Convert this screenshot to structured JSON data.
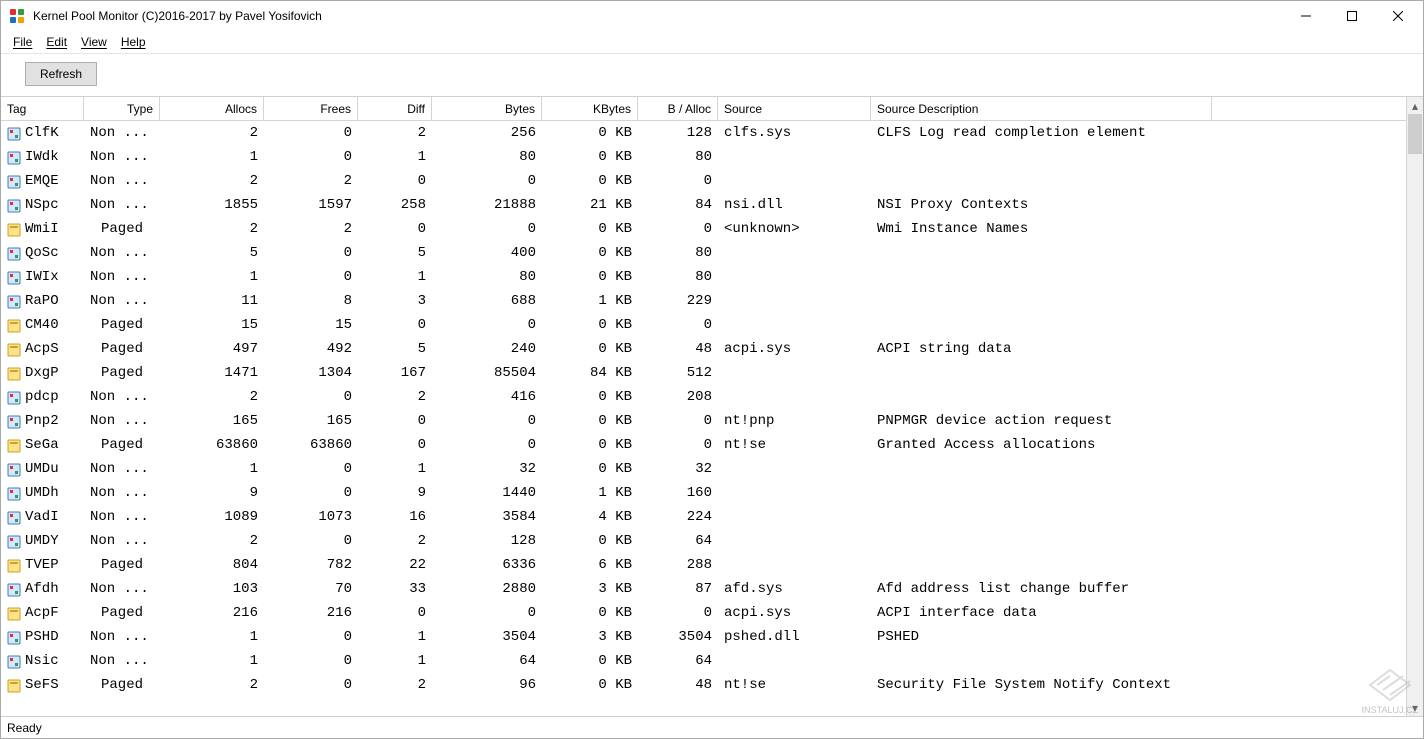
{
  "window": {
    "title": "Kernel Pool Monitor (C)2016-2017 by Pavel Yosifovich"
  },
  "menu": {
    "file": "File",
    "edit": "Edit",
    "view": "View",
    "help": "Help"
  },
  "toolbar": {
    "refresh": "Refresh"
  },
  "columns": [
    "Tag",
    "Type",
    "Allocs",
    "Frees",
    "Diff",
    "Bytes",
    "KBytes",
    "B / Alloc",
    "Source",
    "Source Description"
  ],
  "status": "Ready",
  "watermark": "INSTALUJ.CZ",
  "rows": [
    {
      "icon": "np",
      "tag": "ClfK",
      "type": "Non ...",
      "allocs": 2,
      "frees": 0,
      "diff": 2,
      "bytes": 256,
      "kbytes": "0 KB",
      "balloc": 128,
      "source": "clfs.sys",
      "desc": "CLFS Log read completion element"
    },
    {
      "icon": "np",
      "tag": "IWdk",
      "type": "Non ...",
      "allocs": 1,
      "frees": 0,
      "diff": 1,
      "bytes": 80,
      "kbytes": "0 KB",
      "balloc": 80,
      "source": "",
      "desc": ""
    },
    {
      "icon": "np",
      "tag": "EMQE",
      "type": "Non ...",
      "allocs": 2,
      "frees": 2,
      "diff": 0,
      "bytes": 0,
      "kbytes": "0 KB",
      "balloc": 0,
      "source": "",
      "desc": ""
    },
    {
      "icon": "np",
      "tag": "NSpc",
      "type": "Non ...",
      "allocs": 1855,
      "frees": 1597,
      "diff": 258,
      "bytes": 21888,
      "kbytes": "21 KB",
      "balloc": 84,
      "source": "nsi.dll",
      "desc": "NSI Proxy Contexts"
    },
    {
      "icon": "pg",
      "tag": "WmiI",
      "type": "Paged",
      "allocs": 2,
      "frees": 2,
      "diff": 0,
      "bytes": 0,
      "kbytes": "0 KB",
      "balloc": 0,
      "source": "<unknown>",
      "desc": "Wmi Instance Names"
    },
    {
      "icon": "np",
      "tag": "QoSc",
      "type": "Non ...",
      "allocs": 5,
      "frees": 0,
      "diff": 5,
      "bytes": 400,
      "kbytes": "0 KB",
      "balloc": 80,
      "source": "",
      "desc": ""
    },
    {
      "icon": "np",
      "tag": "IWIx",
      "type": "Non ...",
      "allocs": 1,
      "frees": 0,
      "diff": 1,
      "bytes": 80,
      "kbytes": "0 KB",
      "balloc": 80,
      "source": "",
      "desc": ""
    },
    {
      "icon": "np",
      "tag": "RaPO",
      "type": "Non ...",
      "allocs": 11,
      "frees": 8,
      "diff": 3,
      "bytes": 688,
      "kbytes": "1 KB",
      "balloc": 229,
      "source": "",
      "desc": ""
    },
    {
      "icon": "pg",
      "tag": "CM40",
      "type": "Paged",
      "allocs": 15,
      "frees": 15,
      "diff": 0,
      "bytes": 0,
      "kbytes": "0 KB",
      "balloc": 0,
      "source": "",
      "desc": ""
    },
    {
      "icon": "pg",
      "tag": "AcpS",
      "type": "Paged",
      "allocs": 497,
      "frees": 492,
      "diff": 5,
      "bytes": 240,
      "kbytes": "0 KB",
      "balloc": 48,
      "source": "acpi.sys",
      "desc": "ACPI string data"
    },
    {
      "icon": "pg",
      "tag": "DxgP",
      "type": "Paged",
      "allocs": 1471,
      "frees": 1304,
      "diff": 167,
      "bytes": 85504,
      "kbytes": "84 KB",
      "balloc": 512,
      "source": "",
      "desc": ""
    },
    {
      "icon": "np",
      "tag": "pdcp",
      "type": "Non ...",
      "allocs": 2,
      "frees": 0,
      "diff": 2,
      "bytes": 416,
      "kbytes": "0 KB",
      "balloc": 208,
      "source": "",
      "desc": ""
    },
    {
      "icon": "np",
      "tag": "Pnp2",
      "type": "Non ...",
      "allocs": 165,
      "frees": 165,
      "diff": 0,
      "bytes": 0,
      "kbytes": "0 KB",
      "balloc": 0,
      "source": "nt!pnp",
      "desc": "PNPMGR device action request"
    },
    {
      "icon": "pg",
      "tag": "SeGa",
      "type": "Paged",
      "allocs": 63860,
      "frees": 63860,
      "diff": 0,
      "bytes": 0,
      "kbytes": "0 KB",
      "balloc": 0,
      "source": "nt!se",
      "desc": "Granted Access allocations"
    },
    {
      "icon": "np",
      "tag": "UMDu",
      "type": "Non ...",
      "allocs": 1,
      "frees": 0,
      "diff": 1,
      "bytes": 32,
      "kbytes": "0 KB",
      "balloc": 32,
      "source": "",
      "desc": ""
    },
    {
      "icon": "np",
      "tag": "UMDh",
      "type": "Non ...",
      "allocs": 9,
      "frees": 0,
      "diff": 9,
      "bytes": 1440,
      "kbytes": "1 KB",
      "balloc": 160,
      "source": "",
      "desc": ""
    },
    {
      "icon": "np",
      "tag": "VadI",
      "type": "Non ...",
      "allocs": 1089,
      "frees": 1073,
      "diff": 16,
      "bytes": 3584,
      "kbytes": "4 KB",
      "balloc": 224,
      "source": "",
      "desc": ""
    },
    {
      "icon": "np",
      "tag": "UMDY",
      "type": "Non ...",
      "allocs": 2,
      "frees": 0,
      "diff": 2,
      "bytes": 128,
      "kbytes": "0 KB",
      "balloc": 64,
      "source": "",
      "desc": ""
    },
    {
      "icon": "pg",
      "tag": "TVEP",
      "type": "Paged",
      "allocs": 804,
      "frees": 782,
      "diff": 22,
      "bytes": 6336,
      "kbytes": "6 KB",
      "balloc": 288,
      "source": "",
      "desc": ""
    },
    {
      "icon": "np",
      "tag": "Afdh",
      "type": "Non ...",
      "allocs": 103,
      "frees": 70,
      "diff": 33,
      "bytes": 2880,
      "kbytes": "3 KB",
      "balloc": 87,
      "source": "afd.sys",
      "desc": "Afd address list change buffer"
    },
    {
      "icon": "pg",
      "tag": "AcpF",
      "type": "Paged",
      "allocs": 216,
      "frees": 216,
      "diff": 0,
      "bytes": 0,
      "kbytes": "0 KB",
      "balloc": 0,
      "source": "acpi.sys",
      "desc": "ACPI interface data"
    },
    {
      "icon": "np",
      "tag": "PSHD",
      "type": "Non ...",
      "allocs": 1,
      "frees": 0,
      "diff": 1,
      "bytes": 3504,
      "kbytes": "3 KB",
      "balloc": 3504,
      "source": "pshed.dll",
      "desc": "PSHED"
    },
    {
      "icon": "np",
      "tag": "Nsic",
      "type": "Non ...",
      "allocs": 1,
      "frees": 0,
      "diff": 1,
      "bytes": 64,
      "kbytes": "0 KB",
      "balloc": 64,
      "source": "",
      "desc": ""
    },
    {
      "icon": "pg",
      "tag": "SeFS",
      "type": "Paged",
      "allocs": 2,
      "frees": 0,
      "diff": 2,
      "bytes": 96,
      "kbytes": "0 KB",
      "balloc": 48,
      "source": "nt!se",
      "desc": "Security File System Notify Context"
    }
  ]
}
